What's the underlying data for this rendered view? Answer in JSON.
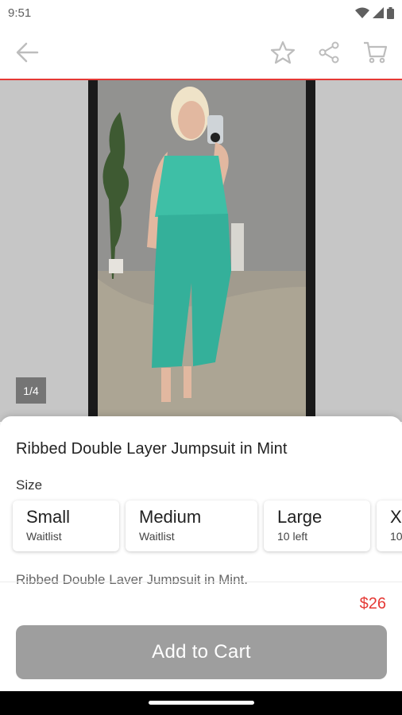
{
  "status_bar": {
    "time": "9:51"
  },
  "gallery": {
    "page_counter": "1/4",
    "image_alt": "Woman wearing mint ribbed jumpsuit taking a mirror selfie"
  },
  "product": {
    "title": "Ribbed Double Layer Jumpsuit in Mint",
    "size_label": "Size",
    "sizes": [
      {
        "name": "Small",
        "status": "Waitlist"
      },
      {
        "name": "Medium",
        "status": "Waitlist"
      },
      {
        "name": "Large",
        "status": "10 left"
      },
      {
        "name": "X",
        "status": "10"
      }
    ],
    "description": "Ribbed Double Layer Jumpsuit in Mint.",
    "price": "$26"
  },
  "actions": {
    "add_to_cart": "Add to Cart"
  },
  "colors": {
    "accent": "#e53935",
    "button_disabled": "#9e9e9e",
    "mint": "#3ebfa6"
  },
  "icons": [
    "back-arrow-icon",
    "star-icon",
    "share-icon",
    "cart-icon",
    "wifi-icon",
    "signal-icon",
    "battery-icon"
  ]
}
